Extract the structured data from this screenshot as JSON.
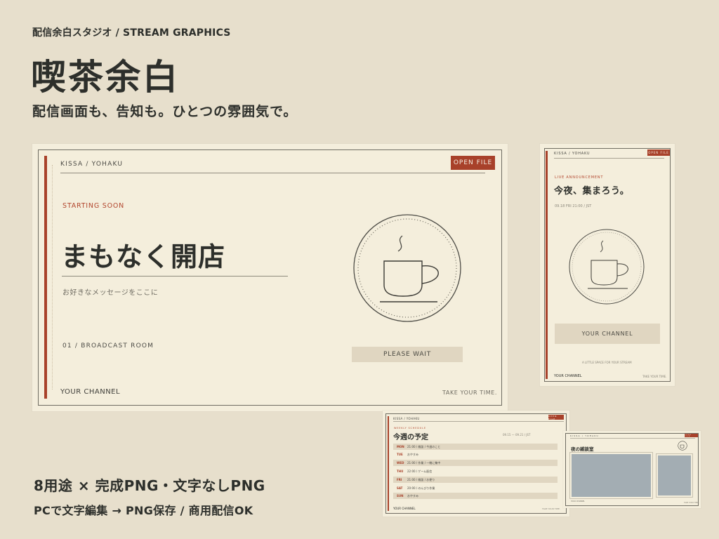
{
  "header": {
    "brand": "配信余白スタジオ / STREAM GRAPHICS",
    "title": "喫茶余白",
    "tagline": "配信画面も、告知も。ひとつの雰囲気で。"
  },
  "main_card": {
    "top_label": "KISSA / YOHAKU",
    "open_button": "OPEN FILE",
    "starting": "STARTING SOON",
    "big_text": "まもなく開店",
    "message": "お好きなメッセージをここに",
    "room": "01 / BROADCAST ROOM",
    "wait_button": "PLEASE WAIT",
    "channel": "YOUR CHANNEL",
    "take": "TAKE YOUR TIME."
  },
  "portrait_card": {
    "top_label": "KISSA / YOHAKU",
    "open_button": "OPEN FILE",
    "live": "LIVE ANNOUNCEMENT",
    "big_text": "今夜、集まろう。",
    "date": "09.18 FRI 21:00 / JST",
    "channel_button": "YOUR CHANNEL",
    "little": "A LITTLE SPACE FOR YOUR STREAM",
    "your": "YOUR CHANNEL",
    "take": "TAKE YOUR TIME."
  },
  "schedule_card": {
    "top_label": "KISSA / YOHAKU",
    "open_button": "OPEN FILE",
    "weekly": "WEEKLY SCHEDULE",
    "title": "今週の予定",
    "range": "09.15 — 09.21 / JST",
    "rows": [
      {
        "day": "MON",
        "text": "21:00 / 雑談 / 今週のこと"
      },
      {
        "day": "TUE",
        "text": "おやすみ"
      },
      {
        "day": "WED",
        "text": "21:00 / 作業 / 一緒に集中"
      },
      {
        "day": "THU",
        "text": "22:00 / ゲーム配信"
      },
      {
        "day": "FRI",
        "text": "21:00 / 雑談 / お便り"
      },
      {
        "day": "SAT",
        "text": "20:00 / のんびり作業"
      },
      {
        "day": "SUN",
        "text": "おやすみ"
      }
    ],
    "footer_left": "YOUR CHANNEL",
    "footer_right": "TAKE YOUR TIME."
  },
  "mini_card": {
    "top_label": "KISSA / YOHAKU",
    "open_button": "OPEN FILE",
    "title": "夜の雑談室",
    "foot_left": "YOUR CHANNEL",
    "foot_right": "TAKE YOUR TIME."
  },
  "bottom": {
    "line1": "8用途 × 完成PNG・文字なしPNG",
    "line2": "PCで文字編集 → PNG保存 / 商用配信OK"
  },
  "colors": {
    "background": "#e7dfcc",
    "card": "#f4eedc",
    "accent": "#a8412a",
    "ink": "#2d2f2b"
  },
  "icons": [
    "coffee-cup-icon"
  ]
}
